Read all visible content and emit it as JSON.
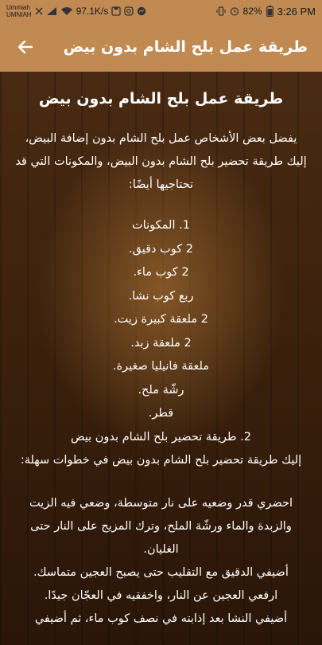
{
  "status_bar": {
    "carrier_line1": "Ummiah",
    "carrier_line2": "UMNIAH",
    "network_speed": "97.1K/s",
    "battery": "82%",
    "time": "3:26 PM"
  },
  "app_bar": {
    "title": "طريقة عمل بلح الشام بدون بيض"
  },
  "article": {
    "title": "طريقة عمل بلح الشام بدون بيض",
    "intro": "يفضل بعض الأشخاص عمل بلح الشام بدون إضافة البيض، إليك طريقة تحضير بلح الشام بدون البيض، والمكونات التي قد تحتاجيها أيضًا:",
    "ingredients": [
      "1. المكونات",
      "2 كوب دقيق.",
      "2 كوب ماء.",
      "ربع كوب نشا.",
      "2 ملعقة كبيرة زيت.",
      "2 ملعقة زبد.",
      "ملعقة فانيليا صغيرة.",
      "رشّة ملح.",
      "قطر.",
      "2. طريقة تحضير بلح الشام بدون بيض",
      "إليك طريقة تحضير بلح الشام بدون بيض في خطوات سهلة:"
    ],
    "steps": [
      "احضري قدر وضعيه على نار متوسطة، وضعي فيه الزيت",
      "والزبدة والماء ورشّة الملح، وترك المزيج على النار حتى",
      "الغليان.",
      "أضيفي الدقيق مع التقليب حتى يصبح العجين متماسك.",
      "ارفعي العجين عن النار، واخفقيه في العجّان جيدًا.",
      "أضيفي النشا بعد إذابته في نصف كوب ماء، ثم أضيفي"
    ]
  }
}
